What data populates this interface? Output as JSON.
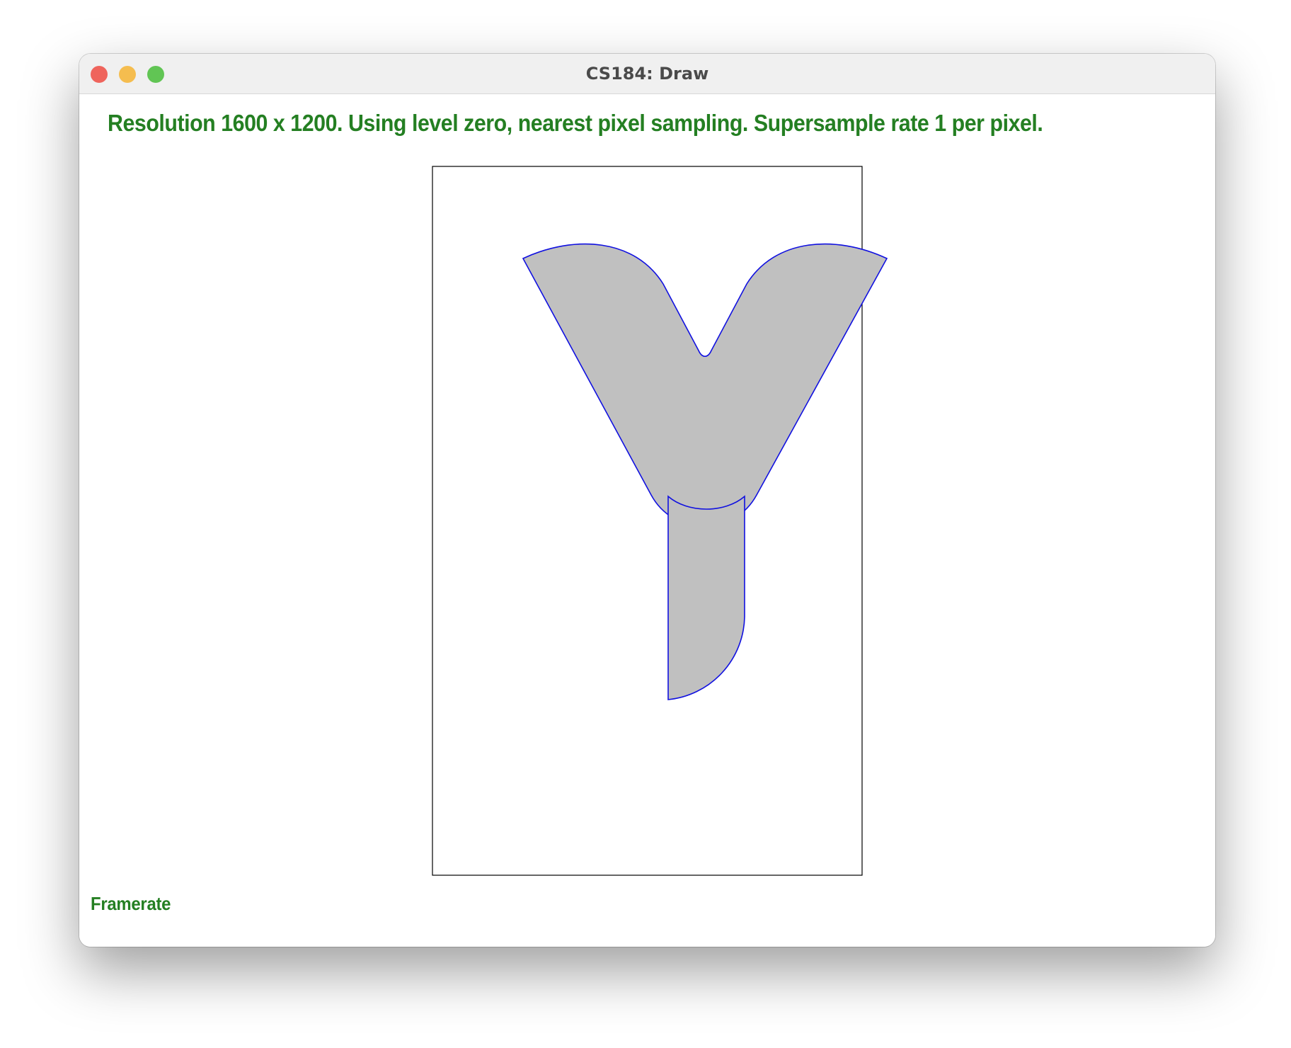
{
  "window": {
    "title": "CS184: Draw"
  },
  "status": {
    "message": "Resolution 1600 x 1200. Using level zero, nearest pixel sampling. Supersample rate 1 per pixel."
  },
  "footer": {
    "framerate_label": "Framerate"
  },
  "colors": {
    "status_text": "#247f22",
    "traffic_close": "#ef645c",
    "traffic_minimize": "#f5bd4f",
    "traffic_zoom": "#61c554",
    "shape_fill": "#c0c0c0",
    "shape_stroke": "#1010e0",
    "frame_stroke": "#000000"
  },
  "drawing": {
    "shapes": [
      "y-shape-upper",
      "y-shape-stem"
    ]
  }
}
